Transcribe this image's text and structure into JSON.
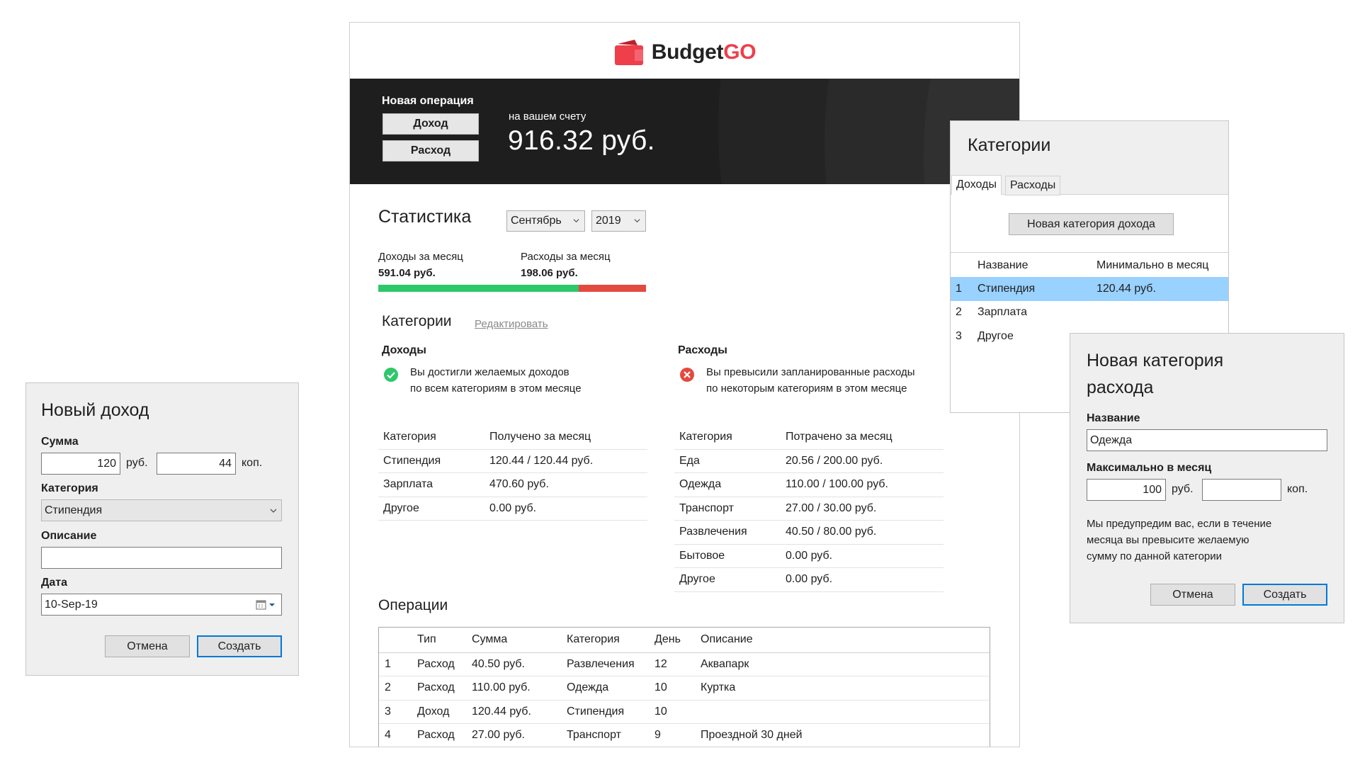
{
  "brand": {
    "name_main": "Budget",
    "name_accent": "GO",
    "accent_color": "#ee3f4b"
  },
  "hero": {
    "new_operation_label": "Новая операция",
    "income_button": "Доход",
    "expense_button": "Расход",
    "balance_label": "на вашем счету",
    "balance_value": "916.32 руб."
  },
  "statistics": {
    "title": "Статистика",
    "month": "Сентябрь",
    "year": "2019",
    "income_label": "Доходы за месяц",
    "income_value": "591.04 руб.",
    "expense_label": "Расходы за месяц",
    "expense_value": "198.06 руб.",
    "income_share": 0.749,
    "income_color": "#2ec76a",
    "expense_color": "#e34a3f"
  },
  "categories": {
    "title": "Категории",
    "edit_link": "Редактировать",
    "income": {
      "heading": "Доходы",
      "status_icon": "check-circle-icon",
      "status_line1": "Вы достигли желаемых доходов",
      "status_line2": "по всем категориям в этом месяце",
      "col_category": "Категория",
      "col_amount": "Получено за месяц",
      "rows": [
        {
          "name": "Стипендия",
          "amount": "120.44 / 120.44 руб."
        },
        {
          "name": "Зарплата",
          "amount": "470.60 руб."
        },
        {
          "name": "Другое",
          "amount": "0.00 руб."
        }
      ]
    },
    "expense": {
      "heading": "Расходы",
      "status_icon": "error-circle-icon",
      "status_line1": "Вы превысили запланированные расходы",
      "status_line2": "по некоторым категориям в этом месяце",
      "col_category": "Категория",
      "col_amount": "Потрачено за месяц",
      "rows": [
        {
          "name": "Еда",
          "amount": "20.56 / 200.00 руб."
        },
        {
          "name": "Одежда",
          "amount": "110.00 / 100.00 руб."
        },
        {
          "name": "Транспорт",
          "amount": "27.00 / 30.00 руб."
        },
        {
          "name": "Развлечения",
          "amount": "40.50 / 80.00 руб."
        },
        {
          "name": "Бытовое",
          "amount": "0.00 руб."
        },
        {
          "name": "Другое",
          "amount": "0.00 руб."
        }
      ]
    }
  },
  "operations": {
    "title": "Операции",
    "columns": [
      "",
      "Тип",
      "Сумма",
      "Категория",
      "День",
      "Описание"
    ],
    "rows": [
      [
        "1",
        "Расход",
        "40.50 руб.",
        "Развлечения",
        "12",
        "Аквапарк"
      ],
      [
        "2",
        "Расход",
        "110.00 руб.",
        "Одежда",
        "10",
        "Куртка"
      ],
      [
        "3",
        "Доход",
        "120.44 руб.",
        "Стипендия",
        "10",
        ""
      ],
      [
        "4",
        "Расход",
        "27.00 руб.",
        "Транспорт",
        "9",
        "Проездной 30 дней"
      ]
    ]
  },
  "new_income_dialog": {
    "title": "Новый доход",
    "sum_label": "Сумма",
    "rub_value": "120",
    "rub_unit": "руб.",
    "kop_value": "44",
    "kop_unit": "коп.",
    "category_label": "Категория",
    "category_value": "Стипендия",
    "description_label": "Описание",
    "description_value": "",
    "date_label": "Дата",
    "date_value": "10-Sep-19",
    "cancel": "Отмена",
    "create": "Создать"
  },
  "categories_window": {
    "title": "Категории",
    "tabs": [
      "Доходы",
      "Расходы"
    ],
    "new_category_button": "Новая категория дохода",
    "col_name": "Название",
    "col_min": "Минимально в месяц",
    "rows": [
      {
        "num": "1",
        "name": "Стипендия",
        "min": "120.44 руб.",
        "selected": true
      },
      {
        "num": "2",
        "name": "Зарплата",
        "min": ""
      },
      {
        "num": "3",
        "name": "Другое",
        "min": ""
      }
    ]
  },
  "new_expense_category_dialog": {
    "title_line1": "Новая категория",
    "title_line2": "расхода",
    "name_label": "Название",
    "name_value": "Одежда",
    "max_label": "Максимально в месяц",
    "rub_value": "100",
    "rub_unit": "руб.",
    "kop_value": "",
    "kop_unit": "коп.",
    "note_line1": "Мы предупредим вас, если в течение",
    "note_line2": "месяца вы превысите желаемую",
    "note_line3": "сумму по данной категории",
    "cancel": "Отмена",
    "create": "Создать"
  }
}
